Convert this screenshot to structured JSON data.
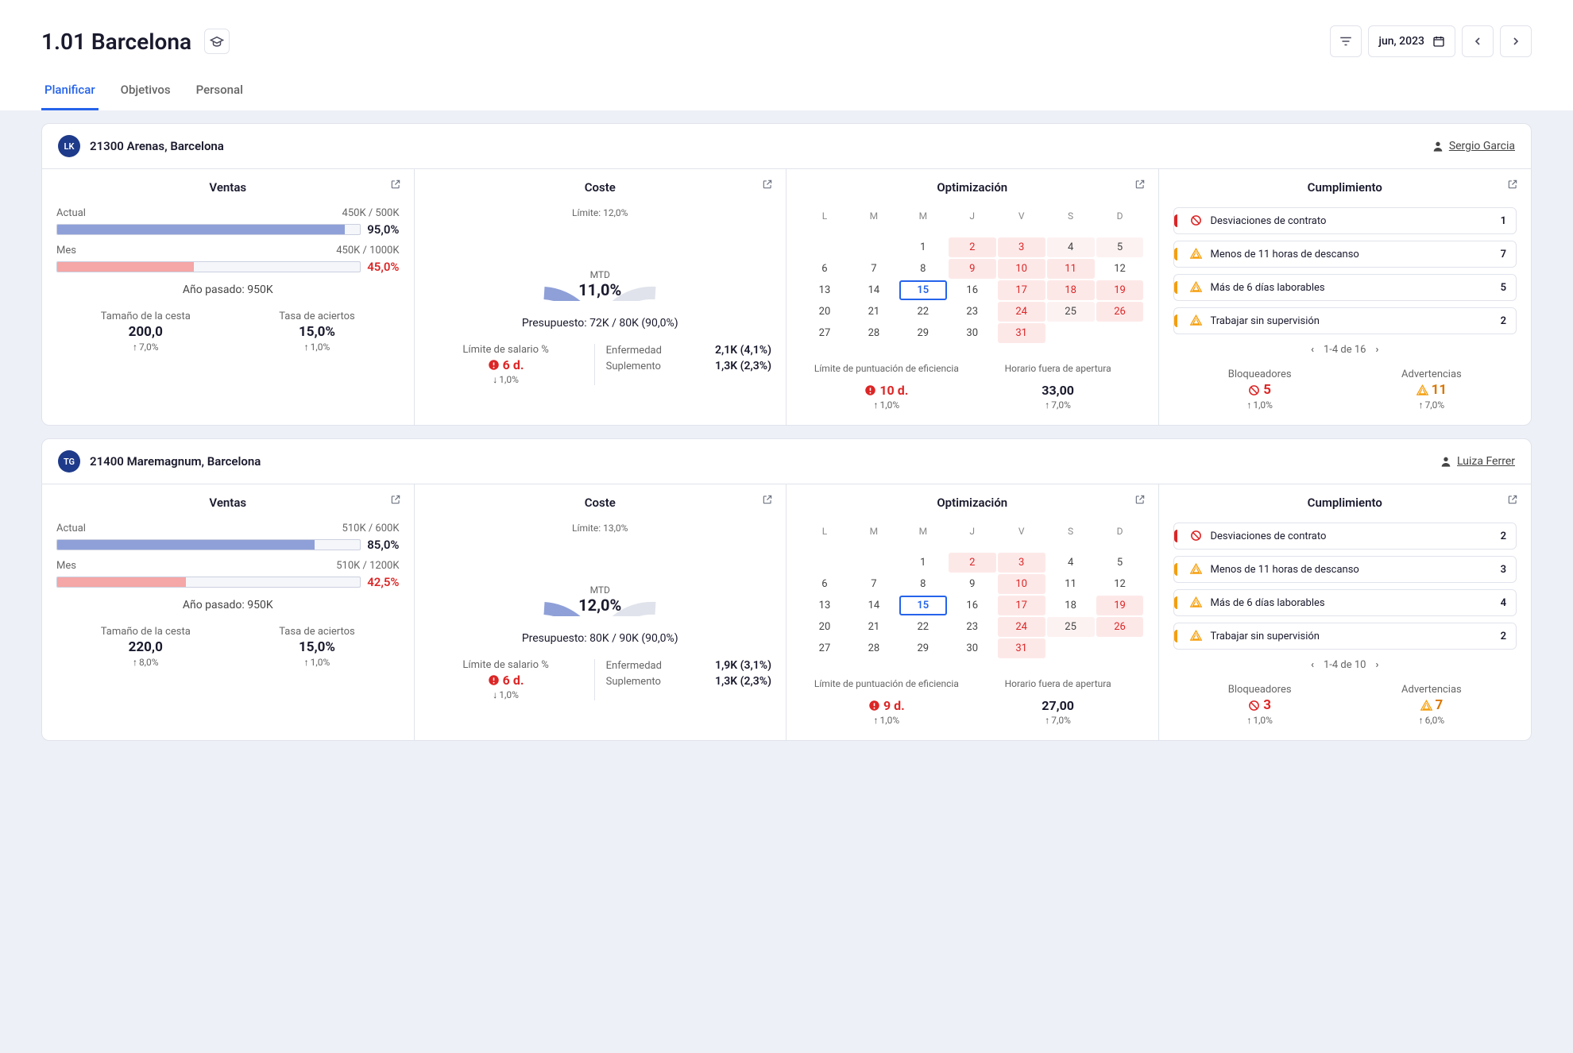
{
  "header": {
    "title": "1.01 Barcelona",
    "date": "jun, 2023"
  },
  "tabs": [
    "Planificar",
    "Objetivos",
    "Personal"
  ],
  "activeTab": 0,
  "labels": {
    "ventas": "Ventas",
    "coste": "Coste",
    "optimizacion": "Optimización",
    "cumplimiento": "Cumplimiento",
    "actual": "Actual",
    "mes": "Mes",
    "anoPasado": "Año pasado:",
    "tamanoCesta": "Tamaño de la cesta",
    "tasaAciertos": "Tasa de aciertos",
    "limite": "Límite:",
    "mtd": "MTD",
    "presupuesto": "Presupuesto:",
    "limiteSalario": "Límite de salario %",
    "enfermedad": "Enfermedad",
    "suplemento": "Suplemento",
    "limitePuntuacion": "Límite de puntuación de eficiencia",
    "horarioFuera": "Horario fuera de apertura",
    "bloqueadores": "Bloqueadores",
    "advertencias": "Advertencias",
    "weekdays": [
      "L",
      "M",
      "M",
      "J",
      "V",
      "S",
      "D"
    ]
  },
  "stores": [
    {
      "avatar": "LK",
      "name": "21300 Arenas, Barcelona",
      "manager": "Sergio Garcia",
      "ventas": {
        "actualRange": "450K / 500K",
        "actualPct": "95,0%",
        "actualFill": 95,
        "mesRange": "450K / 1000K",
        "mesPct": "45,0%",
        "mesFill": 45,
        "lastYear": "950K",
        "basket": "200,0",
        "basketDelta": "7,0%",
        "hitRate": "15,0%",
        "hitRateDelta": "1,0%"
      },
      "coste": {
        "limite": "12,0%",
        "mtd": "11,0%",
        "budget": "72K / 80K (90,0%)",
        "salaryDays": "6 d.",
        "salaryDelta": "1,0%",
        "enfermedad": "2,1K (4,1%)",
        "suplemento": "1,3K (2,3%)"
      },
      "opt": {
        "calendar": [
          [
            null,
            null,
            null,
            null,
            null,
            null,
            null
          ],
          [
            null,
            null,
            "1",
            "2",
            "3",
            "4",
            "5"
          ],
          [
            "6",
            "7",
            "8",
            "9",
            "10",
            "11",
            "12"
          ],
          [
            "13",
            "14",
            "15",
            "16",
            "17",
            "18",
            "19"
          ],
          [
            "20",
            "21",
            "22",
            "23",
            "24",
            "25",
            "26"
          ],
          [
            "27",
            "28",
            "29",
            "30",
            "31",
            null,
            null
          ]
        ],
        "warnDays": [
          "2",
          "3",
          "9",
          "10",
          "11",
          "17",
          "18",
          "19",
          "24",
          "26",
          "31"
        ],
        "lightDays": [
          "4",
          "5",
          "25"
        ],
        "today": "15",
        "eficiencia": "10 d.",
        "eficienciaDelta": "1,0%",
        "horario": "33,00",
        "horarioDelta": "7,0%"
      },
      "comp": {
        "items": [
          {
            "type": "red",
            "text": "Desviaciones de contrato",
            "count": "1"
          },
          {
            "type": "orange",
            "text": "Menos de 11 horas de descanso",
            "count": "7"
          },
          {
            "type": "orange",
            "text": "Más de 6 días laborables",
            "count": "5"
          },
          {
            "type": "orange",
            "text": "Trabajar sin supervisión",
            "count": "2"
          }
        ],
        "pager": "1-4 de 16",
        "bloqueadores": "5",
        "bloqDelta": "1,0%",
        "advertencias": "11",
        "advDelta": "7,0%"
      }
    },
    {
      "avatar": "TG",
      "name": "21400 Maremagnum, Barcelona",
      "manager": "Luiza Ferrer",
      "ventas": {
        "actualRange": "510K / 600K",
        "actualPct": "85,0%",
        "actualFill": 85,
        "mesRange": "510K / 1200K",
        "mesPct": "42,5%",
        "mesFill": 42.5,
        "lastYear": "950K",
        "basket": "220,0",
        "basketDelta": "8,0%",
        "hitRate": "15,0%",
        "hitRateDelta": "1,0%"
      },
      "coste": {
        "limite": "13,0%",
        "mtd": "12,0%",
        "budget": "80K / 90K (90,0%)",
        "salaryDays": "6 d.",
        "salaryDelta": "1,0%",
        "enfermedad": "1,9K (3,1%)",
        "suplemento": "1,3K (2,3%)"
      },
      "opt": {
        "calendar": [
          [
            null,
            null,
            null,
            null,
            null,
            null,
            null
          ],
          [
            null,
            null,
            "1",
            "2",
            "3",
            "4",
            "5"
          ],
          [
            "6",
            "7",
            "8",
            "9",
            "10",
            "11",
            "12"
          ],
          [
            "13",
            "14",
            "15",
            "16",
            "17",
            "18",
            "19"
          ],
          [
            "20",
            "21",
            "22",
            "23",
            "24",
            "25",
            "26"
          ],
          [
            "27",
            "28",
            "29",
            "30",
            "31",
            null,
            null
          ]
        ],
        "warnDays": [
          "2",
          "3",
          "10",
          "17",
          "19",
          "24",
          "26",
          "31"
        ],
        "lightDays": [
          "25"
        ],
        "today": "15",
        "eficiencia": "9 d.",
        "eficienciaDelta": "1,0%",
        "horario": "27,00",
        "horarioDelta": "7,0%"
      },
      "comp": {
        "items": [
          {
            "type": "red",
            "text": "Desviaciones de contrato",
            "count": "2"
          },
          {
            "type": "orange",
            "text": "Menos de 11 horas de descanso",
            "count": "3"
          },
          {
            "type": "orange",
            "text": "Más de 6 días laborables",
            "count": "4"
          },
          {
            "type": "orange",
            "text": "Trabajar sin supervisión",
            "count": "2"
          }
        ],
        "pager": "1-4 de 10",
        "bloqueadores": "3",
        "bloqDelta": "1,0%",
        "advertencias": "7",
        "advDelta": "6,0%"
      }
    }
  ]
}
